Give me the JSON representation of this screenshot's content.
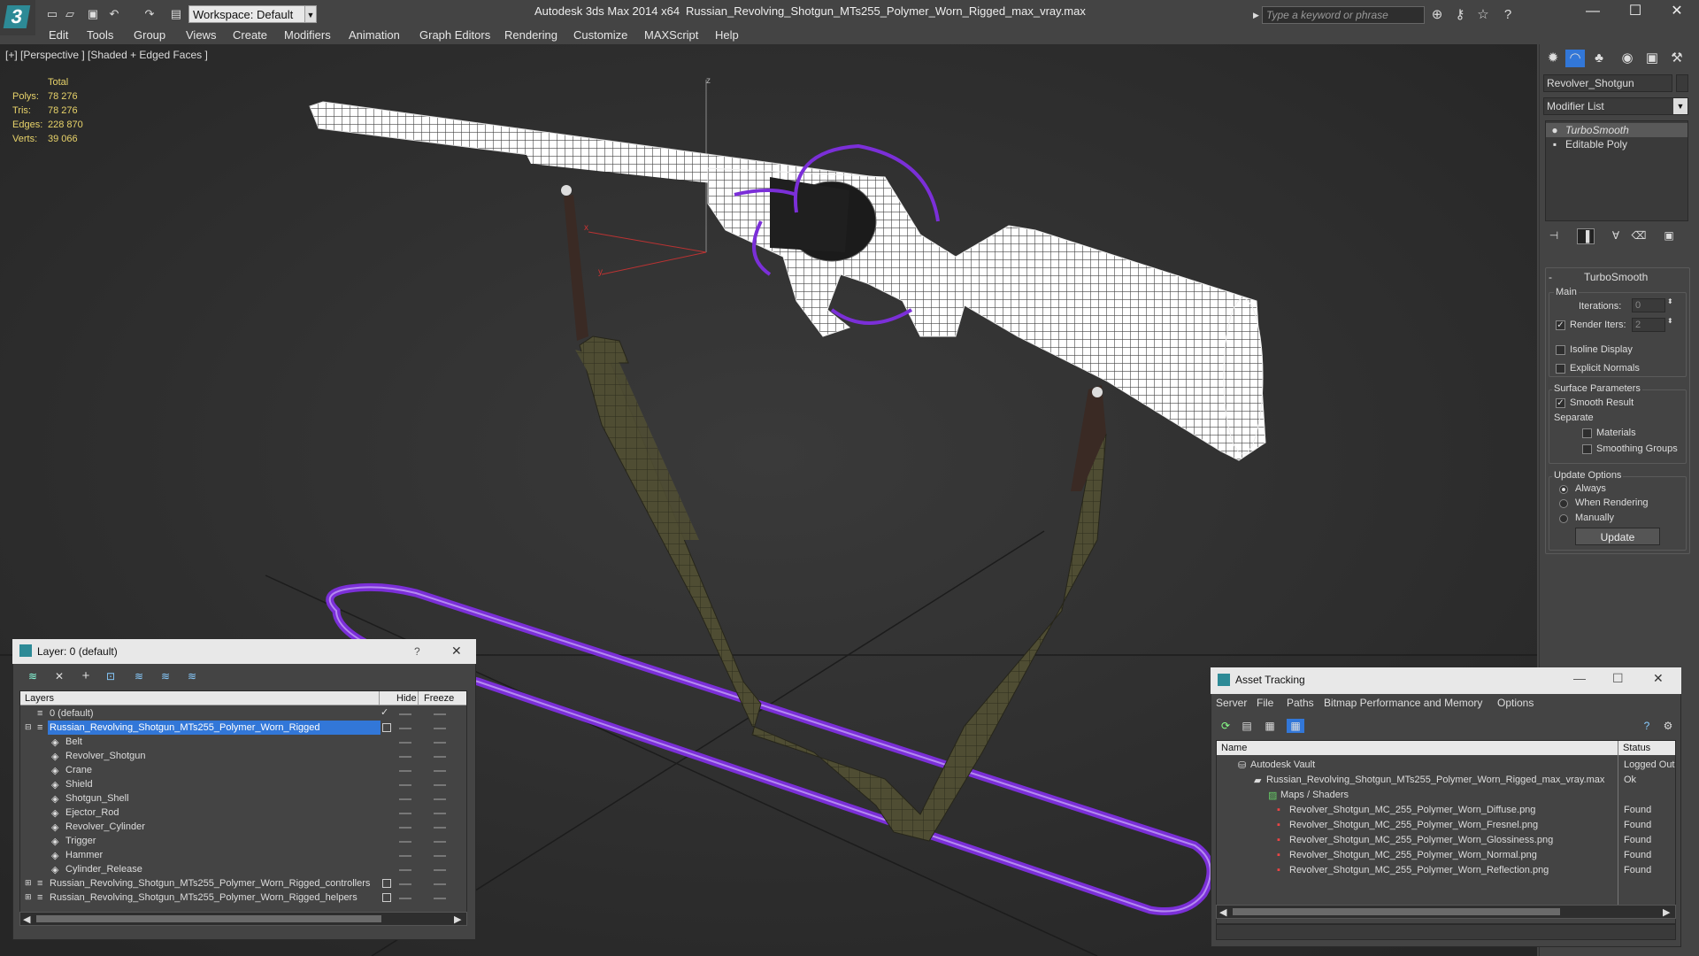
{
  "titlebar": {
    "workspace": "Workspace: Default",
    "app_title": "Autodesk 3ds Max  2014 x64",
    "file_title": "Russian_Revolving_Shotgun_MTs255_Polymer_Worn_Rigged_max_vray.max",
    "search_placeholder": "Type a keyword or phrase",
    "qa_icons": [
      "new-file-icon",
      "open-file-icon",
      "save-icon",
      "undo-icon",
      "redo-icon",
      "project-folder-icon"
    ],
    "tool_icons": [
      "binoculars-icon",
      "key-icon",
      "star-icon",
      "help-icon"
    ]
  },
  "menu": [
    "Edit",
    "Tools",
    "Group",
    "Views",
    "Create",
    "Modifiers",
    "Animation",
    "Graph Editors",
    "Rendering",
    "Customize",
    "MAXScript",
    "Help"
  ],
  "viewport": {
    "label": "[+] [Perspective ] [Shaded + Edged Faces ]",
    "stats": {
      "header": "Total",
      "rows": [
        {
          "label": "Polys:",
          "value": "78 276"
        },
        {
          "label": "Tris:",
          "value": "78 276"
        },
        {
          "label": "Edges:",
          "value": "228 870"
        },
        {
          "label": "Verts:",
          "value": "39 066"
        }
      ]
    },
    "axes": {
      "z": "z",
      "x": "x",
      "y": "y"
    }
  },
  "command_panel": {
    "tab_icons": [
      "create-icon",
      "modify-icon",
      "hierarchy-icon",
      "motion-icon",
      "display-icon",
      "utilities-icon"
    ],
    "object_name": "Revolver_Shotgun",
    "modifier_list": "Modifier List",
    "stack": [
      "TurboSmooth",
      "Editable Poly"
    ],
    "turbosmooth": {
      "title": "TurboSmooth",
      "main": "Main",
      "iterations_label": "Iterations:",
      "iterations_value": "0",
      "render_iters_label": "Render Iters:",
      "render_iters_value": "2",
      "isoline": "Isoline Display",
      "explicit_normals": "Explicit Normals",
      "surface_params": "Surface Parameters",
      "smooth_result": "Smooth Result",
      "separate": "Separate",
      "materials": "Materials",
      "smoothing_groups": "Smoothing Groups",
      "update_options": "Update Options",
      "always": "Always",
      "when_rendering": "When Rendering",
      "manually": "Manually",
      "update_button": "Update"
    }
  },
  "layer_panel": {
    "title": "Layer: 0 (default)",
    "help": "?",
    "columns": {
      "layers": "Layers",
      "hide": "Hide",
      "freeze": "Freeze"
    },
    "rows": [
      {
        "name": "0 (default)",
        "indent": 0
      },
      {
        "name": "Russian_Revolving_Shotgun_MTs255_Polymer_Worn_Rigged",
        "indent": 0,
        "selected": true
      },
      {
        "name": "Belt",
        "indent": 1
      },
      {
        "name": "Revolver_Shotgun",
        "indent": 1
      },
      {
        "name": "Crane",
        "indent": 1
      },
      {
        "name": "Shield",
        "indent": 1
      },
      {
        "name": "Shotgun_Shell",
        "indent": 1
      },
      {
        "name": "Ejector_Rod",
        "indent": 1
      },
      {
        "name": "Revolver_Cylinder",
        "indent": 1
      },
      {
        "name": "Trigger",
        "indent": 1
      },
      {
        "name": "Hammer",
        "indent": 1
      },
      {
        "name": "Cylinder_Release",
        "indent": 1
      },
      {
        "name": "Russian_Revolving_Shotgun_MTs255_Polymer_Worn_Rigged_controllers",
        "indent": 0
      },
      {
        "name": "Russian_Revolving_Shotgun_MTs255_Polymer_Worn_Rigged_helpers",
        "indent": 0
      }
    ]
  },
  "asset_panel": {
    "title": "Asset Tracking",
    "menu": [
      "Server",
      "File",
      "Paths",
      "Bitmap Performance and Memory",
      "Options"
    ],
    "columns": {
      "name": "Name",
      "status": "Status"
    },
    "rows": [
      {
        "name": "Autodesk Vault",
        "status": "Logged Out",
        "indent": 0
      },
      {
        "name": "Russian_Revolving_Shotgun_MTs255_Polymer_Worn_Rigged_max_vray.max",
        "status": "Ok",
        "indent": 1
      },
      {
        "name": "Maps / Shaders",
        "status": "",
        "indent": 2
      },
      {
        "name": "Revolver_Shotgun_MC_255_Polymer_Worn_Diffuse.png",
        "status": "Found",
        "indent": 3
      },
      {
        "name": "Revolver_Shotgun_MC_255_Polymer_Worn_Fresnel.png",
        "status": "Found",
        "indent": 3
      },
      {
        "name": "Revolver_Shotgun_MC_255_Polymer_Worn_Glossiness.png",
        "status": "Found",
        "indent": 3
      },
      {
        "name": "Revolver_Shotgun_MC_255_Polymer_Worn_Normal.png",
        "status": "Found",
        "indent": 3
      },
      {
        "name": "Revolver_Shotgun_MC_255_Polymer_Worn_Reflection.png",
        "status": "Found",
        "indent": 3
      }
    ]
  },
  "colors": {
    "accent": "#2d8a96",
    "selection": "#3277d8",
    "gizmo": "#8a2be2",
    "stats": "#e8d36a"
  }
}
